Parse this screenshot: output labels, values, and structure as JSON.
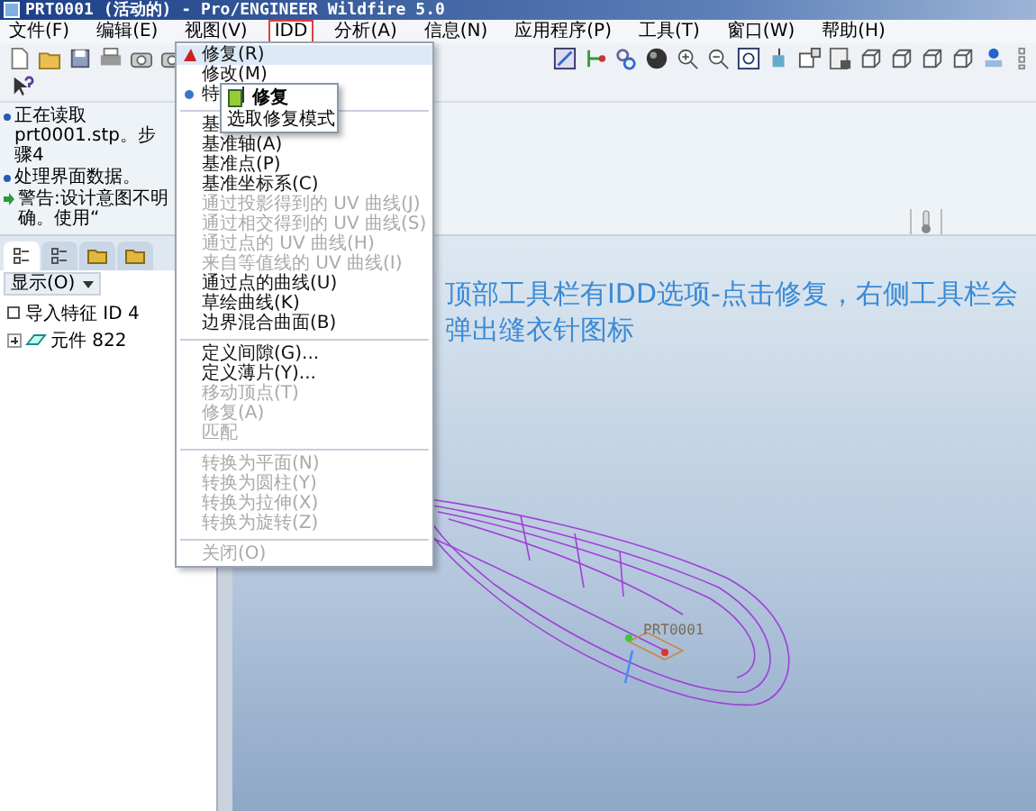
{
  "window": {
    "title": "PRT0001 (活动的) - Pro/ENGINEER Wildfire 5.0"
  },
  "menubar": [
    {
      "label": "文件(F)",
      "selected": false
    },
    {
      "label": "编辑(E)",
      "selected": false
    },
    {
      "label": "视图(V)",
      "selected": false
    },
    {
      "label": "IDD",
      "selected": true
    },
    {
      "label": "分析(A)",
      "selected": false
    },
    {
      "label": "信息(N)",
      "selected": false
    },
    {
      "label": "应用程序(P)",
      "selected": false
    },
    {
      "label": "工具(T)",
      "selected": false
    },
    {
      "label": "窗口(W)",
      "selected": false
    },
    {
      "label": "帮助(H)",
      "selected": false
    }
  ],
  "messages": [
    {
      "kind": "info",
      "text": "正在读取prt0001.stp。步骤4"
    },
    {
      "kind": "info",
      "text": "处理界面数据。"
    },
    {
      "kind": "warning",
      "text": "警告:设计意图不明确。使用“"
    }
  ],
  "model_tree": {
    "tabs": [
      {
        "selected": true
      },
      {
        "selected": false
      },
      {
        "selected": false
      },
      {
        "selected": false
      }
    ],
    "show_menu": "显示(O)",
    "items": [
      {
        "label": "导入特征 ID 4",
        "kind": "feature"
      },
      {
        "label": "元件 822",
        "kind": "part",
        "expanded": false
      }
    ]
  },
  "idd_menu": [
    {
      "kind": "icon-item",
      "label": "修复(R)",
      "selected": true,
      "disabled": false
    },
    {
      "kind": "item",
      "label": "修改(M)",
      "selected": false,
      "disabled": false
    },
    {
      "kind": "dot-item",
      "label": "特",
      "selected": false,
      "disabled": false
    },
    {
      "kind": "separator"
    },
    {
      "kind": "item",
      "label": "基",
      "selected": false,
      "disabled": false
    },
    {
      "kind": "item",
      "label": "基准轴(A)",
      "selected": false,
      "disabled": false
    },
    {
      "kind": "item",
      "label": "基准点(P)",
      "selected": false,
      "disabled": false
    },
    {
      "kind": "item",
      "label": "基准坐标系(C)",
      "selected": false,
      "disabled": false
    },
    {
      "kind": "item",
      "label": "通过投影得到的 UV 曲线(J)",
      "selected": false,
      "disabled": true
    },
    {
      "kind": "item",
      "label": "通过相交得到的 UV 曲线(S)",
      "selected": false,
      "disabled": true
    },
    {
      "kind": "item",
      "label": "通过点的 UV 曲线(H)",
      "selected": false,
      "disabled": true
    },
    {
      "kind": "item",
      "label": "来自等值线的 UV 曲线(I)",
      "selected": false,
      "disabled": true
    },
    {
      "kind": "item",
      "label": "通过点的曲线(U)",
      "selected": false,
      "disabled": false
    },
    {
      "kind": "item",
      "label": "草绘曲线(K)",
      "selected": false,
      "disabled": false
    },
    {
      "kind": "item",
      "label": "边界混合曲面(B)",
      "selected": false,
      "disabled": false
    },
    {
      "kind": "separator"
    },
    {
      "kind": "item",
      "label": "定义间隙(G)...",
      "selected": false,
      "disabled": false
    },
    {
      "kind": "item",
      "label": "定义薄片(Y)...",
      "selected": false,
      "disabled": false
    },
    {
      "kind": "item",
      "label": "移动顶点(T)",
      "selected": false,
      "disabled": true
    },
    {
      "kind": "item",
      "label": "修复(A)",
      "selected": false,
      "disabled": true
    },
    {
      "kind": "item",
      "label": "匹配",
      "selected": false,
      "disabled": true
    },
    {
      "kind": "separator"
    },
    {
      "kind": "item",
      "label": "转换为平面(N)",
      "selected": false,
      "disabled": true
    },
    {
      "kind": "item",
      "label": "转换为圆柱(Y)",
      "selected": false,
      "disabled": true
    },
    {
      "kind": "item",
      "label": "转换为拉伸(X)",
      "selected": false,
      "disabled": true
    },
    {
      "kind": "item",
      "label": "转换为旋转(Z)",
      "selected": false,
      "disabled": true
    },
    {
      "kind": "separator"
    },
    {
      "kind": "item",
      "label": "关闭(O)",
      "selected": false,
      "disabled": true
    }
  ],
  "submenu": [
    {
      "kind": "icon-item",
      "label": "修复"
    },
    {
      "kind": "item",
      "label": "选取修复模式"
    }
  ],
  "viewport": {
    "annotation": "顶部工具栏有IDD选项-点击修复，右侧工具栏会弹出缝衣针图标",
    "model_label": "PRT0001"
  }
}
